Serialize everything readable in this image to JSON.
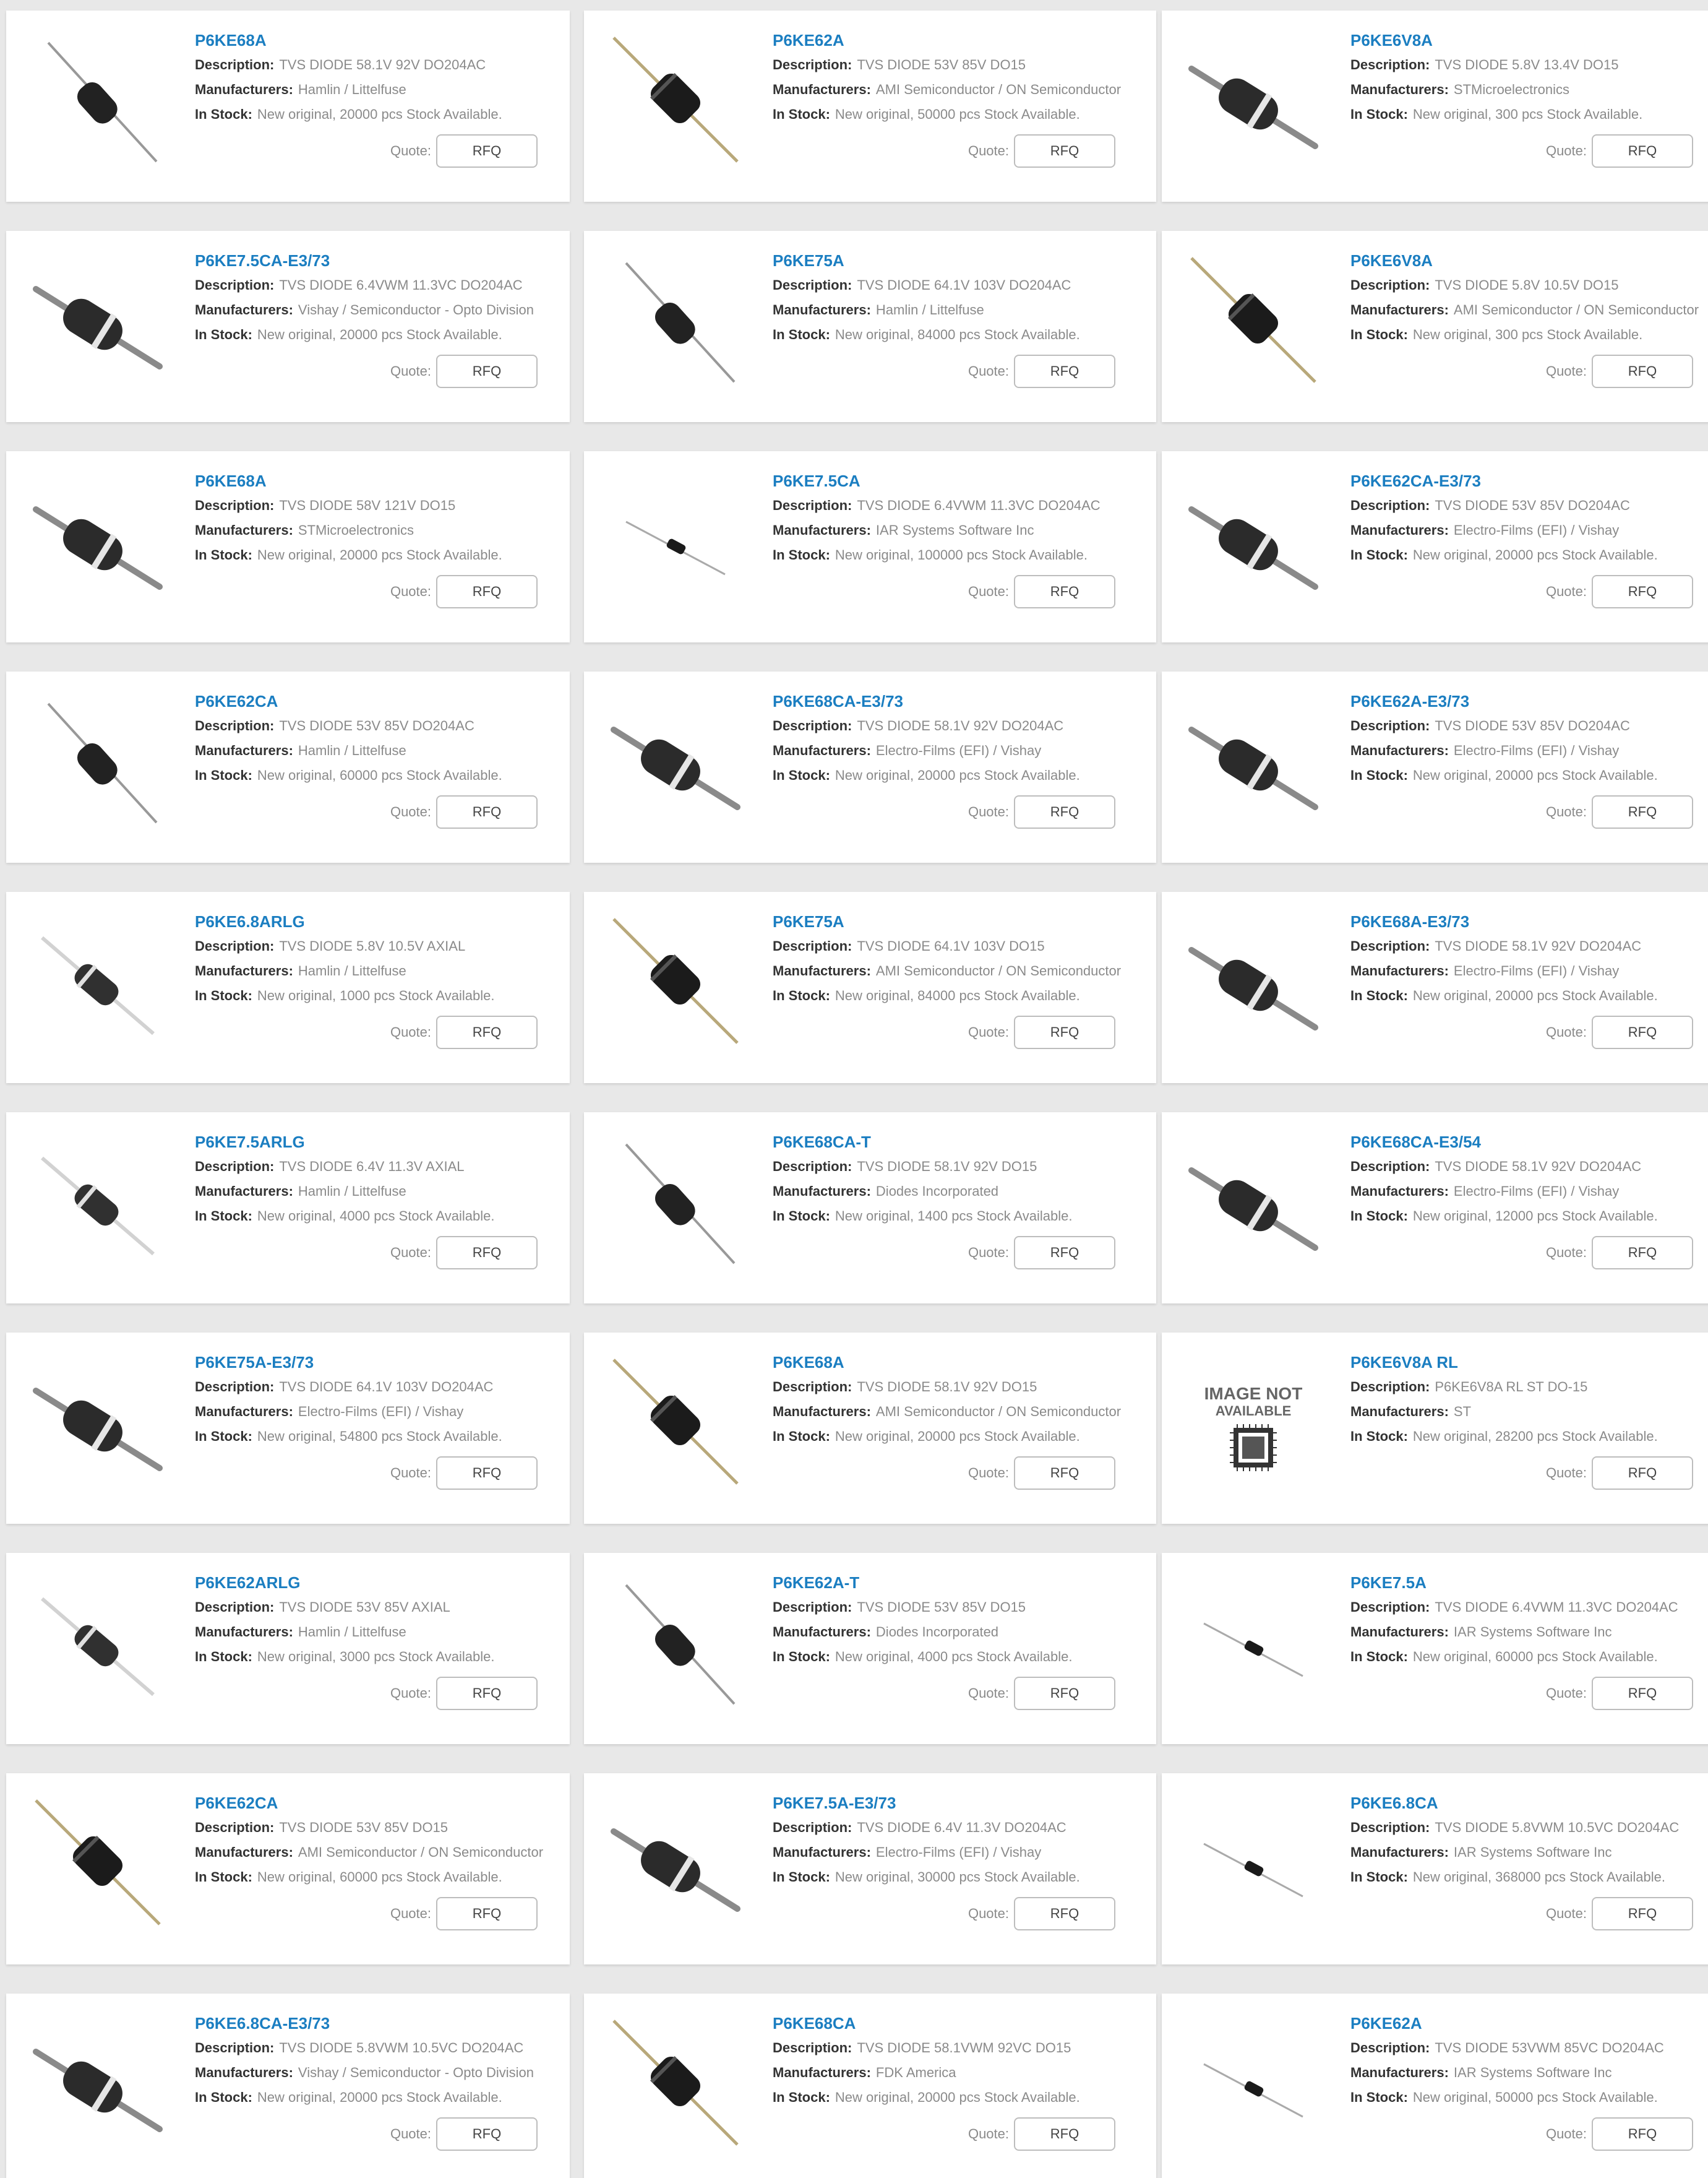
{
  "labels": {
    "description": "Description:",
    "manufacturers": "Manufacturers:",
    "in_stock": "In Stock:",
    "quote": "Quote:",
    "rfq": "RFQ"
  },
  "not_available_image_text": [
    "IMAGE NOT",
    "AVAILABLE"
  ],
  "products": [
    {
      "part": "P6KE68A",
      "description": "TVS DIODE 58.1V 92V DO204AC",
      "manufacturer": "Hamlin / Littelfuse",
      "stock": "New original, 20000 pcs Stock Available.",
      "image": "diode-thin-icon"
    },
    {
      "part": "P6KE62A",
      "description": "TVS DIODE 53V 85V DO15",
      "manufacturer": "AMI Semiconductor / ON Semiconductor",
      "stock": "New original, 50000 pcs Stock Available.",
      "image": "diode-steep-icon"
    },
    {
      "part": "P6KE6V8A",
      "description": "TVS DIODE 5.8V 13.4V DO15",
      "manufacturer": "STMicroelectronics",
      "stock": "New original, 300 pcs Stock Available.",
      "image": "diode-banded-icon"
    },
    {
      "part": "P6KE7.5CA-E3/73",
      "description": "TVS DIODE 6.4VWM 11.3VC DO204AC",
      "manufacturer": "Vishay / Semiconductor - Opto Division",
      "stock": "New original, 20000 pcs Stock Available.",
      "image": "diode-banded-icon"
    },
    {
      "part": "P6KE75A",
      "description": "TVS DIODE 64.1V 103V DO204AC",
      "manufacturer": "Hamlin / Littelfuse",
      "stock": "New original, 84000 pcs Stock Available.",
      "image": "diode-thin-icon"
    },
    {
      "part": "P6KE6V8A",
      "description": "TVS DIODE 5.8V 10.5V DO15",
      "manufacturer": "AMI Semiconductor / ON Semiconductor",
      "stock": "New original, 300 pcs Stock Available.",
      "image": "diode-steep-icon"
    },
    {
      "part": "P6KE68A",
      "description": "TVS DIODE 58V 121V DO15",
      "manufacturer": "STMicroelectronics",
      "stock": "New original, 20000 pcs Stock Available.",
      "image": "diode-banded-icon"
    },
    {
      "part": "P6KE7.5CA",
      "description": "TVS DIODE 6.4VWM 11.3VC DO204AC",
      "manufacturer": "IAR Systems Software Inc",
      "stock": "New original, 100000 pcs Stock Available.",
      "image": "diode-tiny-icon"
    },
    {
      "part": "P6KE62CA-E3/73",
      "description": "TVS DIODE 53V 85V DO204AC",
      "manufacturer": "Electro-Films (EFI) / Vishay",
      "stock": "New original, 20000 pcs Stock Available.",
      "image": "diode-banded-icon"
    },
    {
      "part": "P6KE62CA",
      "description": "TVS DIODE 53V 85V DO204AC",
      "manufacturer": "Hamlin / Littelfuse",
      "stock": "New original, 60000 pcs Stock Available.",
      "image": "diode-thin-icon"
    },
    {
      "part": "P6KE68CA-E3/73",
      "description": "TVS DIODE 58.1V 92V DO204AC",
      "manufacturer": "Electro-Films (EFI) / Vishay",
      "stock": "New original, 20000 pcs Stock Available.",
      "image": "diode-banded-icon"
    },
    {
      "part": "P6KE62A-E3/73",
      "description": "TVS DIODE 53V 85V DO204AC",
      "manufacturer": "Electro-Films (EFI) / Vishay",
      "stock": "New original, 20000 pcs Stock Available.",
      "image": "diode-banded-icon"
    },
    {
      "part": "P6KE6.8ARLG",
      "description": "TVS DIODE 5.8V 10.5V AXIAL",
      "manufacturer": "Hamlin / Littelfuse",
      "stock": "New original, 1000 pcs Stock Available.",
      "image": "diode-silver-icon"
    },
    {
      "part": "P6KE75A",
      "description": "TVS DIODE 64.1V 103V DO15",
      "manufacturer": "AMI Semiconductor / ON Semiconductor",
      "stock": "New original, 84000 pcs Stock Available.",
      "image": "diode-steep-icon"
    },
    {
      "part": "P6KE68A-E3/73",
      "description": "TVS DIODE 58.1V 92V DO204AC",
      "manufacturer": "Electro-Films (EFI) / Vishay",
      "stock": "New original, 20000 pcs Stock Available.",
      "image": "diode-banded-icon"
    },
    {
      "part": "P6KE7.5ARLG",
      "description": "TVS DIODE 6.4V 11.3V AXIAL",
      "manufacturer": "Hamlin / Littelfuse",
      "stock": "New original, 4000 pcs Stock Available.",
      "image": "diode-silver-icon"
    },
    {
      "part": "P6KE68CA-T",
      "description": "TVS DIODE 58.1V 92V DO15",
      "manufacturer": "Diodes Incorporated",
      "stock": "New original, 1400 pcs Stock Available.",
      "image": "diode-thin-icon"
    },
    {
      "part": "P6KE68CA-E3/54",
      "description": "TVS DIODE 58.1V 92V DO204AC",
      "manufacturer": "Electro-Films (EFI) / Vishay",
      "stock": "New original, 12000 pcs Stock Available.",
      "image": "diode-banded-icon"
    },
    {
      "part": "P6KE75A-E3/73",
      "description": "TVS DIODE 64.1V 103V DO204AC",
      "manufacturer": "Electro-Films (EFI) / Vishay",
      "stock": "New original, 54800 pcs Stock Available.",
      "image": "diode-banded-icon"
    },
    {
      "part": "P6KE68A",
      "description": "TVS DIODE 58.1V 92V DO15",
      "manufacturer": "AMI Semiconductor / ON Semiconductor",
      "stock": "New original, 20000 pcs Stock Available.",
      "image": "diode-steep-icon"
    },
    {
      "part": "P6KE6V8A RL",
      "description": "P6KE6V8A RL ST DO-15",
      "manufacturer": "ST",
      "stock": "New original, 28200 pcs Stock Available.",
      "image": "image-not-available-icon"
    },
    {
      "part": "P6KE62ARLG",
      "description": "TVS DIODE 53V 85V AXIAL",
      "manufacturer": "Hamlin / Littelfuse",
      "stock": "New original, 3000 pcs Stock Available.",
      "image": "diode-silver-icon"
    },
    {
      "part": "P6KE62A-T",
      "description": "TVS DIODE 53V 85V DO15",
      "manufacturer": "Diodes Incorporated",
      "stock": "New original, 4000 pcs Stock Available.",
      "image": "diode-thin-icon"
    },
    {
      "part": "P6KE7.5A",
      "description": "TVS DIODE 6.4VWM 11.3VC DO204AC",
      "manufacturer": "IAR Systems Software Inc",
      "stock": "New original, 60000 pcs Stock Available.",
      "image": "diode-tiny-icon"
    },
    {
      "part": "P6KE62CA",
      "description": "TVS DIODE 53V 85V DO15",
      "manufacturer": "AMI Semiconductor / ON Semiconductor",
      "stock": "New original, 60000 pcs Stock Available.",
      "image": "diode-steep-icon"
    },
    {
      "part": "P6KE7.5A-E3/73",
      "description": "TVS DIODE 6.4V 11.3V DO204AC",
      "manufacturer": "Electro-Films (EFI) / Vishay",
      "stock": "New original, 30000 pcs Stock Available.",
      "image": "diode-banded-icon"
    },
    {
      "part": "P6KE6.8CA",
      "description": "TVS DIODE 5.8VWM 10.5VC DO204AC",
      "manufacturer": "IAR Systems Software Inc",
      "stock": "New original, 368000 pcs Stock Available.",
      "image": "diode-tiny-icon"
    },
    {
      "part": "P6KE6.8CA-E3/73",
      "description": "TVS DIODE 5.8VWM 10.5VC DO204AC",
      "manufacturer": "Vishay / Semiconductor - Opto Division",
      "stock": "New original, 20000 pcs Stock Available.",
      "image": "diode-banded-icon"
    },
    {
      "part": "P6KE68CA",
      "description": "TVS DIODE 58.1VWM 92VC DO15",
      "manufacturer": "FDK America",
      "stock": "New original, 20000 pcs Stock Available.",
      "image": "diode-steep-icon"
    },
    {
      "part": "P6KE62A",
      "description": "TVS DIODE 53VWM 85VC DO204AC",
      "manufacturer": "IAR Systems Software Inc",
      "stock": "New original, 50000 pcs Stock Available.",
      "image": "diode-tiny-icon"
    }
  ]
}
